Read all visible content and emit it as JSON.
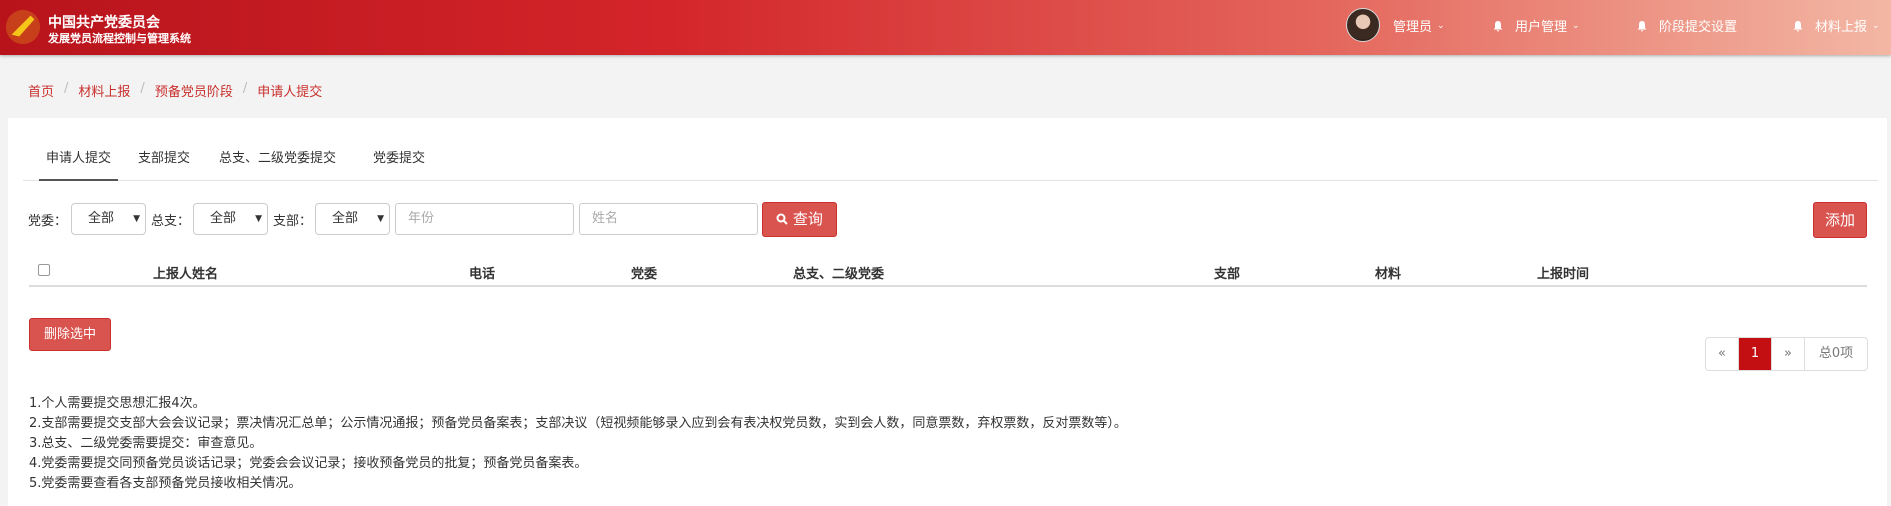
{
  "header": {
    "title_line1": "中国共产党委员会",
    "title_line2": "发展党员流程控制与管理系统",
    "nav": [
      {
        "label": "管理员",
        "caret": "⌄"
      },
      {
        "label": "用户管理",
        "caret": "⌄"
      },
      {
        "label": "阶段提交设置",
        "caret": ""
      },
      {
        "label": "材料上报",
        "caret": "⌄"
      }
    ]
  },
  "breadcrumb": [
    "首页",
    "材料上报",
    "预备党员阶段",
    "申请人提交"
  ],
  "tabs": [
    "申请人提交",
    "支部提交",
    "总支、二级党委提交",
    "党委提交"
  ],
  "filters": {
    "party_label": "党委：",
    "general_label": "总支：",
    "branch_label": "支部：",
    "party_value": "全部",
    "general_value": "全部",
    "branch_value": "全部",
    "year_placeholder": "年份",
    "name_placeholder": "姓名",
    "query_label": "查询",
    "add_label": "添加"
  },
  "table": {
    "columns": [
      "上报人姓名",
      "电话",
      "党委",
      "总支、二级党委",
      "支部",
      "材料",
      "上报时间"
    ],
    "rows": []
  },
  "delete_selected_label": "删除选中",
  "pagination": {
    "prev": "«",
    "current": "1",
    "next": "»",
    "total": "总0项"
  },
  "notes": [
    "1.个人需要提交思想汇报4次。",
    "2.支部需要提交支部大会会议记录；票决情况汇总单；公示情况通报；预备党员备案表；支部决议（短视频能够录入应到会有表决权党员数，实到会人数，同意票数，弃权票数，反对票数等）。",
    "3.总支、二级党委需要提交：审查意见。",
    "4.党委需要提交同预备党员谈话记录；党委会会议记录；接收预备党员的批复；预备党员备案表。",
    "5.党委需要查看各支部预备党员接收相关情况。"
  ],
  "colors": {
    "brand_red": "#c40f12",
    "button_red": "#d9534f",
    "link_red": "#c9302c"
  }
}
